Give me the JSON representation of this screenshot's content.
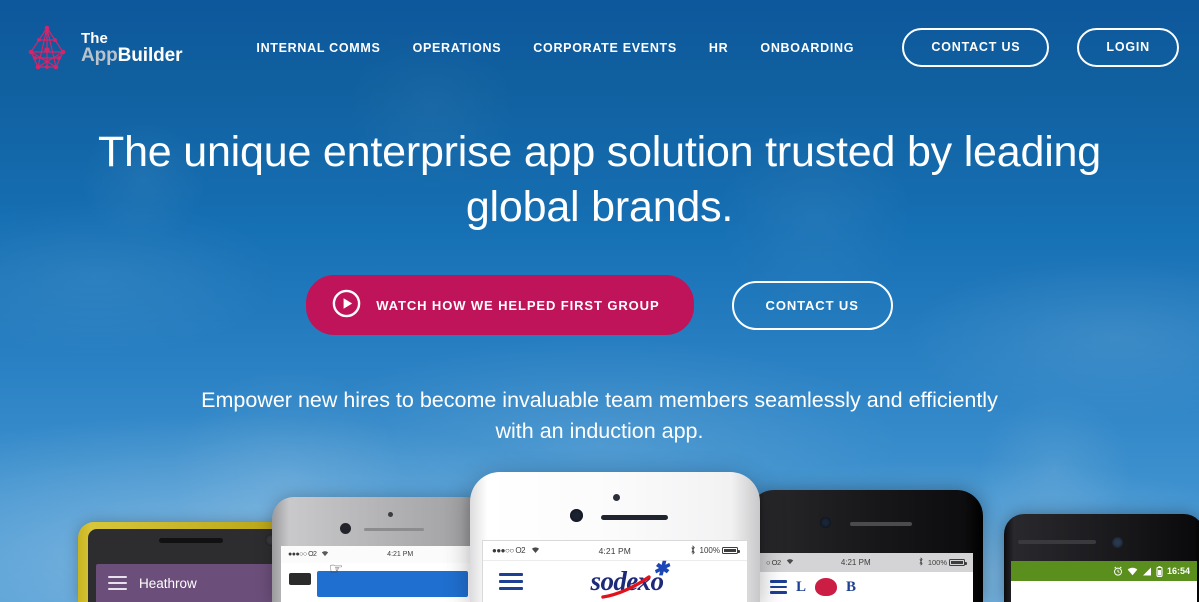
{
  "colors": {
    "sky_top": "#0d579c",
    "sky_bottom": "#4d9bd4",
    "accent_crimson": "#bf1459",
    "white": "#ffffff",
    "logo_pink": "#d6246b",
    "logo_grey": "#b9c3cc"
  },
  "header": {
    "logo": {
      "line1": "The",
      "app": "App",
      "builder": "Builder",
      "mark": "network-logo-icon"
    },
    "nav": [
      {
        "label": "INTERNAL COMMS",
        "name": "nav-internal-comms"
      },
      {
        "label": "OPERATIONS",
        "name": "nav-operations"
      },
      {
        "label": "CORPORATE EVENTS",
        "name": "nav-corporate-events"
      },
      {
        "label": "HR",
        "name": "nav-hr"
      },
      {
        "label": "ONBOARDING",
        "name": "nav-onboarding"
      }
    ],
    "contact_button": "CONTACT US",
    "login_button": "LOGIN"
  },
  "hero": {
    "headline": "The unique enterprise app solution trusted by leading global brands.",
    "watch_button": "WATCH HOW WE HELPED FIRST GROUP",
    "watch_icon": "play-circle-icon",
    "contact_button": "CONTACT US",
    "subheadline": "Empower new hires to become invaluable team members seamlessly and efficiently with an induction app."
  },
  "phones": {
    "phone1": {
      "device": "yellow-phone",
      "app_title": "Heathrow",
      "menu_icon": "hamburger-menu-icon"
    },
    "phone2": {
      "device": "silver-iphone",
      "carrier": "●●●○○ O2",
      "wifi_icon": "wifi-icon",
      "time": "4:21 PM",
      "cursor_icon": "hand-cursor-icon"
    },
    "phone3": {
      "device": "white-iphone",
      "carrier": "●●●○○ O2",
      "wifi_icon": "wifi-icon",
      "time": "4:21 PM",
      "bluetooth_icon": "bluetooth-icon",
      "battery": "100%",
      "battery_icon": "battery-full-icon",
      "menu_icon": "hamburger-menu-icon",
      "brand": "sodexo"
    },
    "phone4": {
      "device": "black-iphone",
      "carrier": "○ O2",
      "wifi_icon": "wifi-icon",
      "time": "4:21 PM",
      "bluetooth_icon": "bluetooth-icon",
      "battery": "100%",
      "battery_icon": "battery-full-icon",
      "menu_icon": "hamburger-menu-icon"
    },
    "phone5": {
      "device": "android-phone",
      "alarm_icon": "alarm-clock-icon",
      "wifi_icon": "wifi-icon",
      "signal_icon": "signal-bars-icon",
      "battery_icon": "battery-icon",
      "time": "16:54"
    }
  }
}
